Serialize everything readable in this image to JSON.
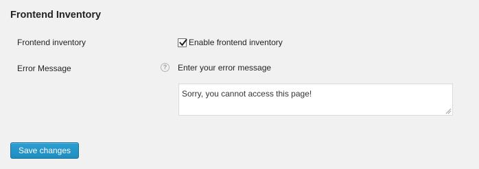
{
  "section": {
    "title": "Frontend Inventory"
  },
  "fields": {
    "inventory": {
      "label": "Frontend inventory",
      "checkbox_label": "Enable frontend inventory",
      "checked": true
    },
    "error_message": {
      "label": "Error Message",
      "help_icon": "question-circle-icon",
      "hint": "Enter your error message",
      "value": "Sorry, you cannot access this page!"
    }
  },
  "actions": {
    "save_label": "Save changes"
  },
  "colors": {
    "background": "#f1f1f1",
    "primary_button": "#1e8cbe"
  }
}
